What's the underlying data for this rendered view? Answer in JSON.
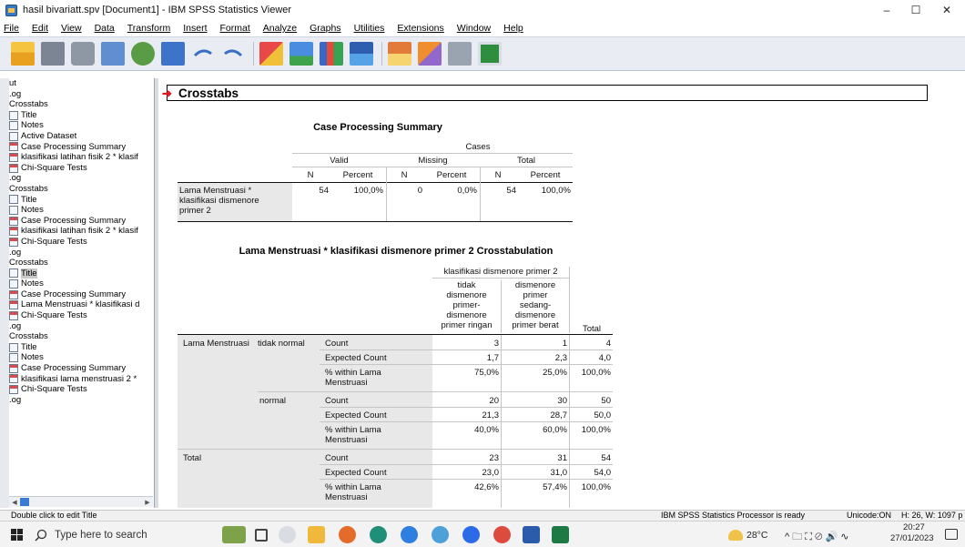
{
  "window": {
    "title": "hasil bivariatt.spv [Document1] - IBM SPSS Statistics Viewer",
    "minimize": "–",
    "maximize": "☐",
    "close": "✕"
  },
  "menu": [
    "File",
    "Edit",
    "View",
    "Data",
    "Transform",
    "Insert",
    "Format",
    "Analyze",
    "Graphs",
    "Utilities",
    "Extensions",
    "Window",
    "Help"
  ],
  "outline": [
    {
      "label": "ut",
      "icon": "none"
    },
    {
      "label": ".og",
      "icon": "none"
    },
    {
      "label": "Crosstabs",
      "icon": "none"
    },
    {
      "label": "Title",
      "icon": "title"
    },
    {
      "label": "Notes",
      "icon": "notes"
    },
    {
      "label": "Active Dataset",
      "icon": "notes"
    },
    {
      "label": "Case Processing Summary",
      "icon": "table"
    },
    {
      "label": "klasifikasi latihan fisik 2  * klasif",
      "icon": "table"
    },
    {
      "label": "Chi-Square Tests",
      "icon": "table"
    },
    {
      "label": ".og",
      "icon": "none"
    },
    {
      "label": "Crosstabs",
      "icon": "none"
    },
    {
      "label": "Title",
      "icon": "title"
    },
    {
      "label": "Notes",
      "icon": "notes"
    },
    {
      "label": "Case Processing Summary",
      "icon": "table"
    },
    {
      "label": "klasifikasi latihan fisik 2  * klasif",
      "icon": "table"
    },
    {
      "label": "Chi-Square Tests",
      "icon": "table"
    },
    {
      "label": ".og",
      "icon": "none"
    },
    {
      "label": "Crosstabs",
      "icon": "none"
    },
    {
      "label": "Title",
      "icon": "title",
      "selected": true
    },
    {
      "label": "Notes",
      "icon": "notes"
    },
    {
      "label": "Case Processing Summary",
      "icon": "table"
    },
    {
      "label": "Lama Menstruasi * klasifikasi d",
      "icon": "table"
    },
    {
      "label": "Chi-Square Tests",
      "icon": "table"
    },
    {
      "label": ".og",
      "icon": "none"
    },
    {
      "label": "Crosstabs",
      "icon": "none"
    },
    {
      "label": "Title",
      "icon": "title"
    },
    {
      "label": "Notes",
      "icon": "notes"
    },
    {
      "label": "Case Processing Summary",
      "icon": "table"
    },
    {
      "label": "klasifikasi lama menstruasi 2  *",
      "icon": "table"
    },
    {
      "label": "Chi-Square Tests",
      "icon": "table"
    },
    {
      "label": ".og",
      "icon": "none"
    }
  ],
  "content": {
    "heading": "Crosstabs",
    "case_summary": {
      "title": "Case Processing Summary",
      "cases_label": "Cases",
      "groups": [
        "Valid",
        "Missing",
        "Total"
      ],
      "subheaders": [
        "N",
        "Percent",
        "N",
        "Percent",
        "N",
        "Percent"
      ],
      "row_label_lines": [
        "Lama Menstruasi *",
        "klasifikasi dismenore",
        "primer 2"
      ],
      "values": [
        "54",
        "100,0%",
        "0",
        "0,0%",
        "54",
        "100,0%"
      ]
    },
    "crosstab": {
      "title": "Lama Menstruasi * klasifikasi dismenore primer 2 Crosstabulation",
      "col_group": "klasifikasi dismenore primer 2",
      "col1_lines": [
        "tidak",
        "dismenore",
        "primer-",
        "dismenore",
        "primer ringan"
      ],
      "col2_lines": [
        "dismenore",
        "primer",
        "sedang-",
        "dismenore",
        "primer berat"
      ],
      "total_label": "Total",
      "row_var": "Lama Menstruasi",
      "groups": [
        {
          "name": "tidak normal",
          "rows": [
            {
              "stat": "Count",
              "stat2": "",
              "v1": "3",
              "v2": "1",
              "tot": "4"
            },
            {
              "stat": "Expected Count",
              "stat2": "",
              "v1": "1,7",
              "v2": "2,3",
              "tot": "4,0"
            },
            {
              "stat": "% within Lama",
              "stat2": "Menstruasi",
              "v1": "75,0%",
              "v2": "25,0%",
              "tot": "100,0%"
            }
          ]
        },
        {
          "name": "normal",
          "rows": [
            {
              "stat": "Count",
              "stat2": "",
              "v1": "20",
              "v2": "30",
              "tot": "50"
            },
            {
              "stat": "Expected Count",
              "stat2": "",
              "v1": "21,3",
              "v2": "28,7",
              "tot": "50,0"
            },
            {
              "stat": "% within Lama",
              "stat2": "Menstruasi",
              "v1": "40,0%",
              "v2": "60,0%",
              "tot": "100,0%"
            }
          ]
        }
      ],
      "total_row": {
        "name": "Total",
        "rows": [
          {
            "stat": "Count",
            "stat2": "",
            "v1": "23",
            "v2": "31",
            "tot": "54"
          },
          {
            "stat": "Expected Count",
            "stat2": "",
            "v1": "23,0",
            "v2": "31,0",
            "tot": "54,0"
          },
          {
            "stat": "% within Lama",
            "stat2": "Menstruasi",
            "v1": "42,6%",
            "v2": "57,4%",
            "tot": "100,0%"
          }
        ]
      }
    }
  },
  "status": {
    "hint": "Double click to edit Title",
    "processor": "IBM SPSS Statistics Processor is ready",
    "unicode": "Unicode:ON",
    "size": "H: 26, W: 1097 p"
  },
  "taskbar": {
    "search_placeholder": "Type here to search",
    "weather": "28°C",
    "time": "20:27",
    "date": "27/01/2023"
  }
}
